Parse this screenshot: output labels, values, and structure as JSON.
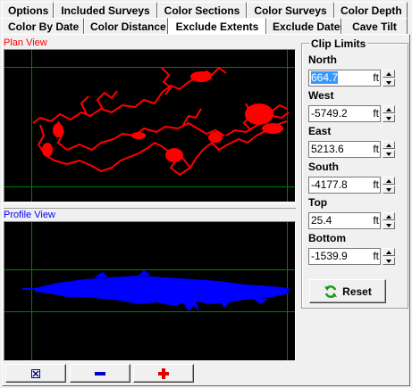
{
  "tabs_row1": [
    "Options",
    "Included Surveys",
    "Color Sections",
    "Color Surveys",
    "Color Depth"
  ],
  "tabs_row2": [
    "Color By Date",
    "Color Distance",
    "Exclude Extents",
    "Exclude Dates",
    "Cave Tilt"
  ],
  "active_tab": "Exclude Extents",
  "plan_view": {
    "label": "Plan View",
    "color": "#ff0000"
  },
  "profile_view": {
    "label": "Profile View",
    "color": "#0000ff"
  },
  "grid_color": "#008000",
  "clip_limits": {
    "title": "Clip Limits",
    "fields": [
      {
        "label": "North",
        "value": "664.7",
        "unit": "ft"
      },
      {
        "label": "West",
        "value": "-5749.2",
        "unit": "ft"
      },
      {
        "label": "East",
        "value": "5213.6",
        "unit": "ft"
      },
      {
        "label": "South",
        "value": "-4177.8",
        "unit": "ft"
      },
      {
        "label": "Top",
        "value": "25.4",
        "unit": "ft"
      },
      {
        "label": "Bottom",
        "value": "-1539.9",
        "unit": "ft"
      }
    ],
    "reset_label": "Reset"
  },
  "zoom_buttons": [
    {
      "name": "zoom-extents-button",
      "icon": "zoom-extents-icon"
    },
    {
      "name": "zoom-out-button",
      "icon": "minus-icon"
    },
    {
      "name": "zoom-in-button",
      "icon": "plus-icon"
    }
  ]
}
